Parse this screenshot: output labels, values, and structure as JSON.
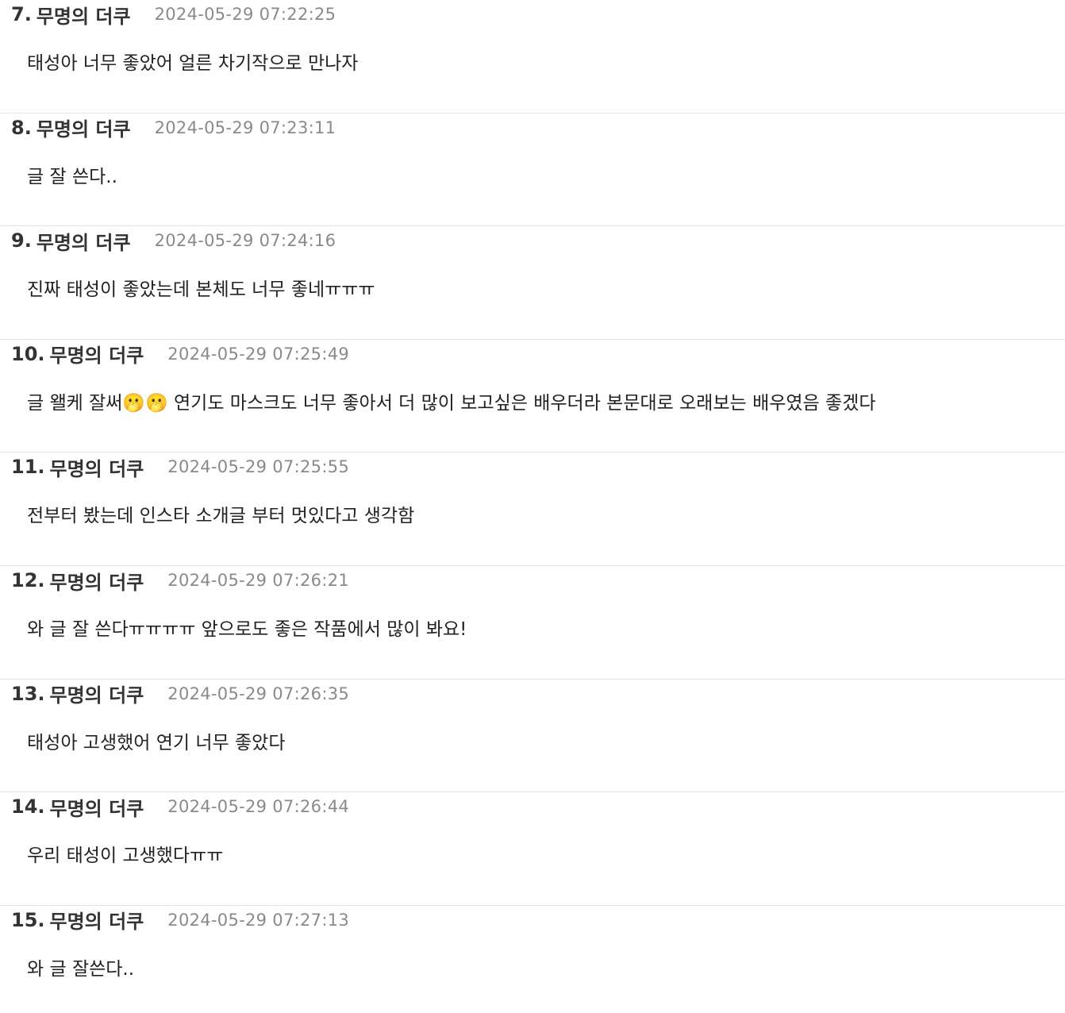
{
  "comments": [
    {
      "number": "7.",
      "author": "무명의 더쿠",
      "date": "2024-05-29 07:22:25",
      "text": "태성아 너무 좋았어 얼른 차기작으로 만나자"
    },
    {
      "number": "8.",
      "author": "무명의 더쿠",
      "date": "2024-05-29 07:23:11",
      "text": "글 잘 쓴다.."
    },
    {
      "number": "9.",
      "author": "무명의 더쿠",
      "date": "2024-05-29 07:24:16",
      "text": "진짜 태성이 좋았는데 본체도 너무 좋네ㅠㅠㅠ"
    },
    {
      "number": "10.",
      "author": "무명의 더쿠",
      "date": "2024-05-29 07:25:49",
      "text": "글 왤케 잘써🫢🫢 연기도 마스크도 너무 좋아서 더 많이 보고싶은 배우더라 본문대로 오래보는 배우였음 좋겠다"
    },
    {
      "number": "11.",
      "author": "무명의 더쿠",
      "date": "2024-05-29 07:25:55",
      "text": "전부터 봤는데 인스타 소개글 부터 멋있다고 생각함"
    },
    {
      "number": "12.",
      "author": "무명의 더쿠",
      "date": "2024-05-29 07:26:21",
      "text": "와 글 잘 쓴다ㅠㅠㅠㅠ 앞으로도 좋은 작품에서 많이 봐요!"
    },
    {
      "number": "13.",
      "author": "무명의 더쿠",
      "date": "2024-05-29 07:26:35",
      "text": "태성아 고생했어 연기 너무 좋았다"
    },
    {
      "number": "14.",
      "author": "무명의 더쿠",
      "date": "2024-05-29 07:26:44",
      "text": "우리 태성이 고생했다ㅠㅠ"
    },
    {
      "number": "15.",
      "author": "무명의 더쿠",
      "date": "2024-05-29 07:27:13",
      "text": "와 글 잘쓴다.."
    }
  ]
}
